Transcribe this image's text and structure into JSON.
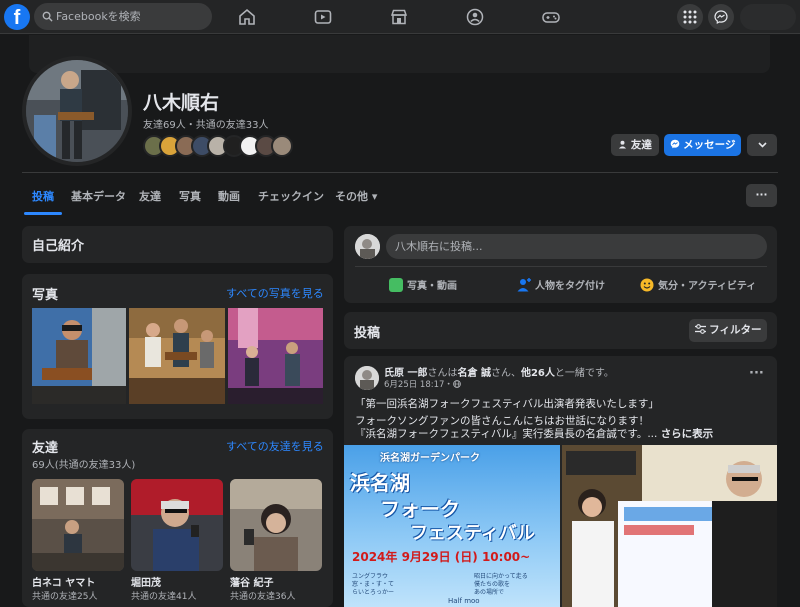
{
  "topnav": {
    "search_placeholder": "Facebookを検索",
    "logo_letter": "f",
    "nav_icons": [
      "home-icon",
      "video-icon",
      "marketplace-icon",
      "groups-icon",
      "gaming-icon"
    ],
    "right_icons": [
      "menu-grid-icon",
      "messenger-icon"
    ]
  },
  "profile": {
    "name": "八木順右",
    "friends_line": "友達69人・共通の友達33人",
    "btn_friend": "友達",
    "btn_message": "メッセージ",
    "btn_more": "⌄"
  },
  "tabs": [
    {
      "label": "投稿",
      "active": true
    },
    {
      "label": "基本データ"
    },
    {
      "label": "友達"
    },
    {
      "label": "写真"
    },
    {
      "label": "動画"
    },
    {
      "label": "チェックイン"
    },
    {
      "label": "その他 ▾"
    }
  ],
  "tab_more": "···",
  "intro": {
    "title": "自己紹介"
  },
  "photos": {
    "title": "写真",
    "see_all": "すべての写真を見る"
  },
  "friends": {
    "title": "友達",
    "count": "69人(共通の友達33人)",
    "see_all": "すべての友達を見る",
    "list": [
      {
        "name": "白ネコ ヤマト",
        "mutual": "共通の友達25人"
      },
      {
        "name": "堀田茂",
        "mutual": "共通の友達41人"
      },
      {
        "name": "藩谷 紀子",
        "mutual": "共通の友達36人"
      }
    ]
  },
  "composer": {
    "placeholder": "八木順右に投稿...",
    "photo_video": "写真・動画",
    "tag_people": "人物をタグ付け",
    "feeling": "気分・アクティビティ"
  },
  "posts_header": {
    "title": "投稿",
    "filter": "フィルター"
  },
  "post": {
    "author": "氏原 一郎",
    "with_text": "さんは",
    "tagged": "名倉 誠",
    "with_text2": "さん、",
    "others": "他26人",
    "with_text3": "と一緒です。",
    "time": "6月25日 18:17・",
    "line1": "「第一回浜名湖フォークフェスティバル出演者発表いたします」",
    "line2": "フォークソングファンの皆さんこんにちはお世話になります！",
    "line3": "『浜名湖フォークフェスティバル』実行委員長の名倉誠です。...",
    "see_more": "さらに表示",
    "dots": "···"
  },
  "poster": {
    "top": "浜名湖ガーデンパーク",
    "t1": "浜名湖",
    "t2": "フォーク",
    "t3": "フェスティバル",
    "date": "2024年 9月29日 (日) 10:00~",
    "note": "昭日に向かって走る\n僕たちの歌を\nあの場所で",
    "small": "ユングフラウ\n窓・ま・す・て\nらいとろっかー",
    "bottom": "Half moo"
  },
  "colors": {
    "accent": "#2d88ff",
    "message_button": "#1b74e4",
    "background": "#18191a",
    "card": "#242526"
  }
}
